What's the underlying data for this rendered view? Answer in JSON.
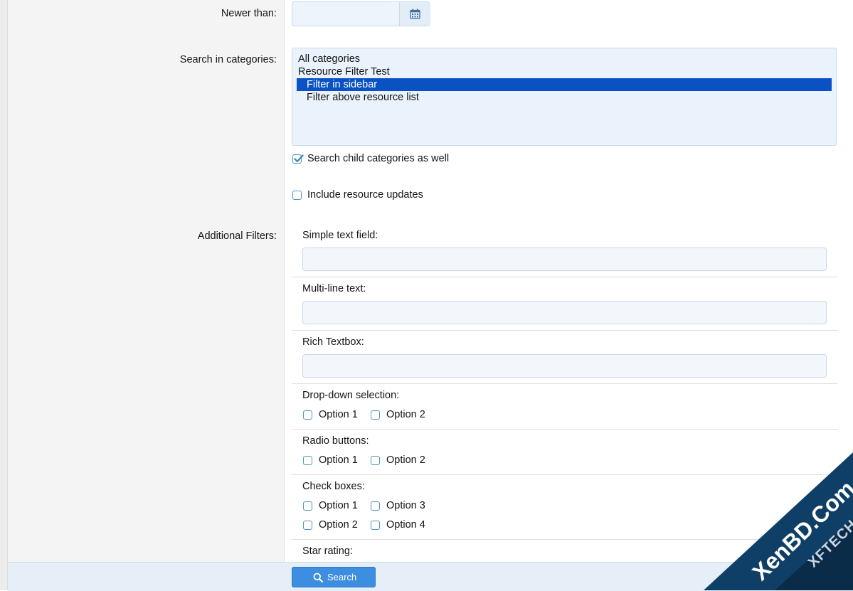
{
  "form": {
    "newer_than": {
      "label": "Newer than:",
      "value": ""
    },
    "categories": {
      "label": "Search in categories:",
      "options": [
        "All categories",
        "Resource Filter Test",
        "Filter in sidebar",
        "Filter above resource list"
      ],
      "selected": "Filter in sidebar",
      "search_child": {
        "label": "Search child categories as well",
        "checked": true
      }
    },
    "include_updates": {
      "label": "Include resource updates",
      "checked": false
    }
  },
  "filters": {
    "label": "Additional Filters:",
    "simple_text": {
      "label": "Simple text field:",
      "value": ""
    },
    "multiline": {
      "label": "Multi-line text:",
      "value": ""
    },
    "rich": {
      "label": "Rich Textbox:",
      "value": ""
    },
    "dropdown": {
      "label": "Drop-down selection:",
      "options": [
        "Option 1",
        "Option 2"
      ]
    },
    "radio": {
      "label": "Radio buttons:",
      "options": [
        "Option 1",
        "Option 2"
      ]
    },
    "checkboxes": {
      "label": "Check boxes:",
      "options": [
        "Option 1",
        "Option 3",
        "Option 2",
        "Option 4"
      ]
    },
    "star": {
      "label": "Star rating:"
    }
  },
  "footer": {
    "search_label": "Search"
  },
  "watermark": {
    "line1": "XenBD.Com",
    "line2": "XFTECH"
  },
  "colors": {
    "accent": "#3d8de0",
    "selected": "#0a52c4",
    "checkbox": "#4f95bd"
  },
  "icons": {
    "date": "calendar-icon",
    "search": "search-icon"
  }
}
